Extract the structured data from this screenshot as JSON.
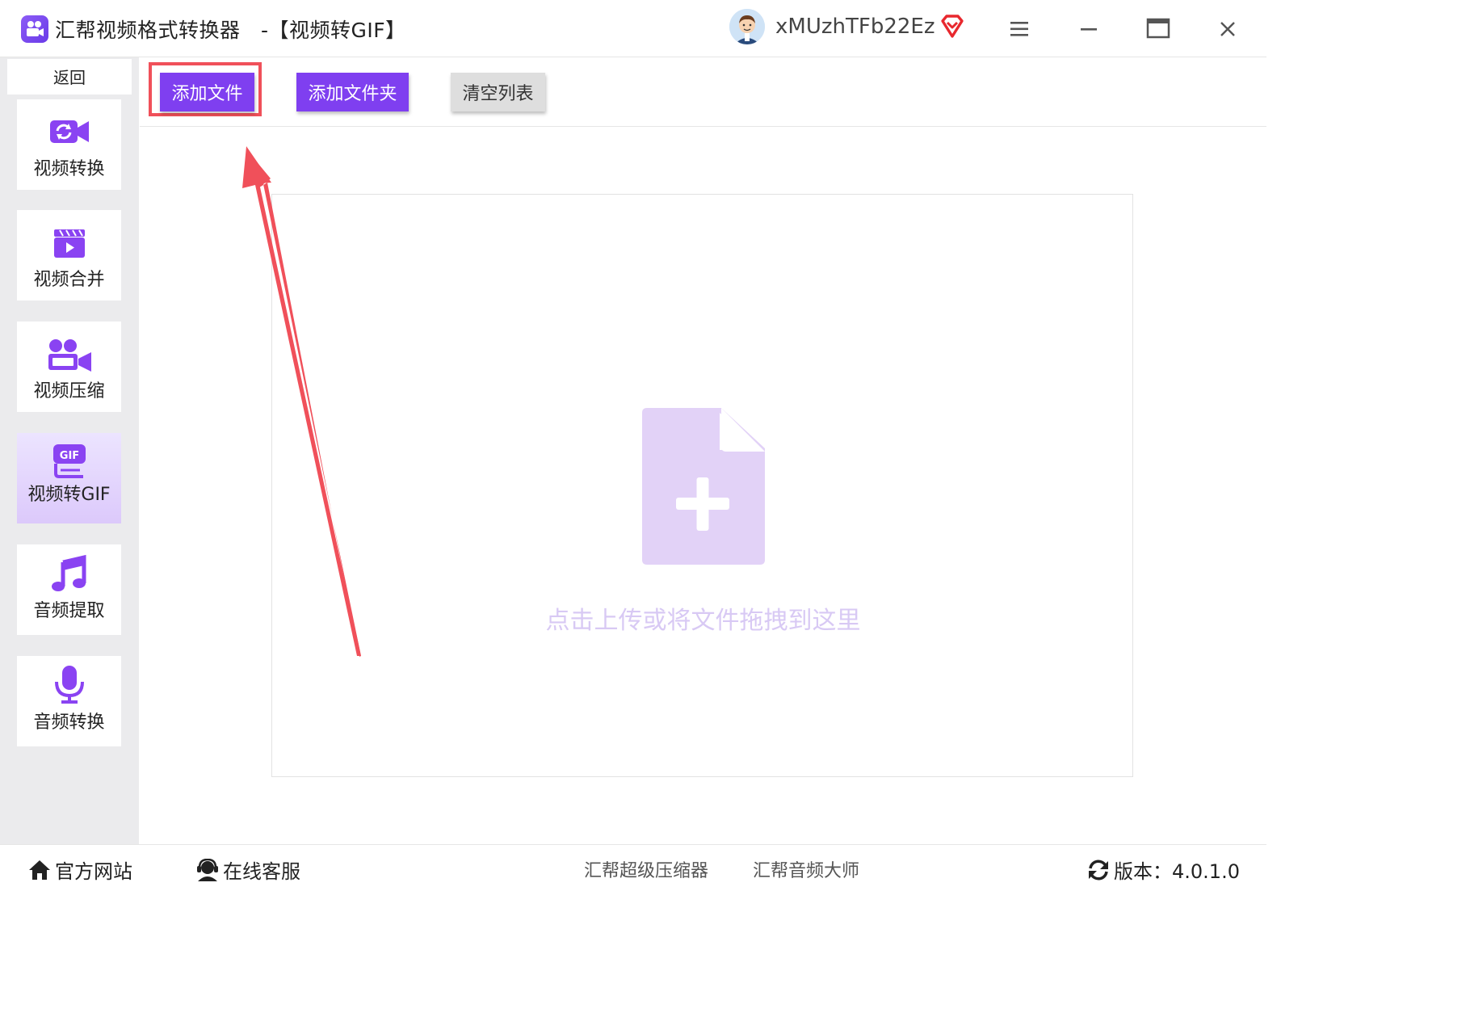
{
  "app": {
    "title": "汇帮视频格式转换器　-【视频转GIF】",
    "username": "xMUzhTFb22Ez"
  },
  "sidebar": {
    "back_label": "返回",
    "items": [
      {
        "label": "视频转换",
        "icon": "video-convert-icon"
      },
      {
        "label": "视频合并",
        "icon": "video-merge-icon"
      },
      {
        "label": "视频压缩",
        "icon": "video-compress-icon"
      },
      {
        "label": "视频转GIF",
        "icon": "gif-icon",
        "active": true
      },
      {
        "label": "音频提取",
        "icon": "music-note-icon"
      },
      {
        "label": "音频转换",
        "icon": "microphone-icon"
      }
    ]
  },
  "toolbar": {
    "add_file": "添加文件",
    "add_folder": "添加文件夹",
    "clear_list": "清空列表"
  },
  "dropzone": {
    "hint": "点击上传或将文件拖拽到这里"
  },
  "footer": {
    "website": "官方网站",
    "support": "在线客服",
    "compressor": "汇帮超级压缩器",
    "audio_master": "汇帮音频大师",
    "version": "版本：4.0.1.0"
  },
  "colors": {
    "accent": "#7f3ff0",
    "icon_purple": "#8a43f2",
    "highlight_red": "#f0505a",
    "drop_icon": "#e2d2f7"
  }
}
